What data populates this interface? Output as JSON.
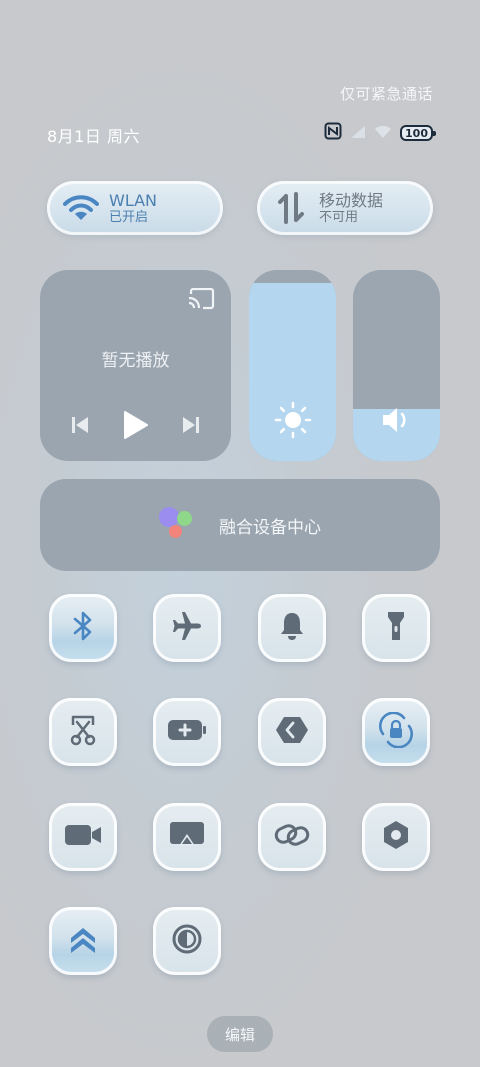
{
  "status": {
    "emergency_text": "仅可紧急通话",
    "date": "8月1日 周六",
    "battery": "100",
    "icons": [
      "nfc-icon",
      "signal-icon",
      "wifi-icon",
      "battery-icon"
    ]
  },
  "wlan": {
    "title": "WLAN",
    "subtitle": "已开启",
    "active": true
  },
  "mobile_data": {
    "title": "移动数据",
    "subtitle": "不可用",
    "active": false
  },
  "media": {
    "empty_text": "暂无播放",
    "controls": [
      "previous",
      "play",
      "next"
    ]
  },
  "brightness": {
    "level": 0.93
  },
  "volume": {
    "level": 0.27
  },
  "fusion": {
    "label": "融合设备中心"
  },
  "tiles": [
    {
      "name": "bluetooth",
      "icon": "bluetooth-icon",
      "active": true
    },
    {
      "name": "airplane-mode",
      "icon": "airplane-icon",
      "active": false
    },
    {
      "name": "ring-mode",
      "icon": "bell-icon",
      "active": false
    },
    {
      "name": "flashlight",
      "icon": "flashlight-icon",
      "active": false
    },
    {
      "name": "screenshot",
      "icon": "scissors-icon",
      "active": false
    },
    {
      "name": "battery-saver",
      "icon": "battery-plus-icon",
      "active": false
    },
    {
      "name": "huawei-share",
      "icon": "share-icon",
      "active": false
    },
    {
      "name": "auto-rotate",
      "icon": "rotation-lock-icon",
      "active": true
    },
    {
      "name": "screen-record",
      "icon": "video-camera-icon",
      "active": false
    },
    {
      "name": "wireless-projection",
      "icon": "cast-screen-icon",
      "active": false
    },
    {
      "name": "hotspot",
      "icon": "link-icon",
      "active": false
    },
    {
      "name": "nfc",
      "icon": "hexagon-icon",
      "active": false
    },
    {
      "name": "performance-mode",
      "icon": "double-chevron-up-icon",
      "active": true
    },
    {
      "name": "eye-comfort",
      "icon": "contrast-icon",
      "active": false
    }
  ],
  "edit_label": "编辑"
}
